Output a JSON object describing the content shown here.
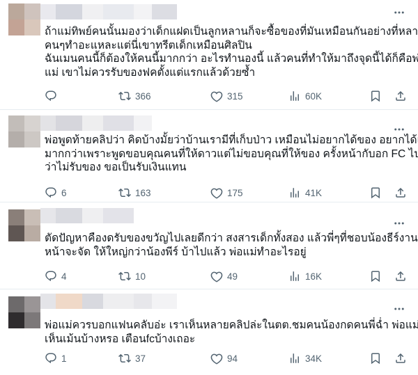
{
  "replies": [
    {
      "avatar_colors": [
        "#bba89b",
        "#cfc3bd",
        "#c3a395",
        "#d9c7bb"
      ],
      "header_blur": [
        "#e9e9ee",
        "#d4d6de",
        "#f0f0f2",
        "#e8eaef",
        "#f3f3f5",
        "#dcdde3"
      ],
      "lines": [
        "ถ้าแม่ทิพย์คนนั้นมองว่าเด็กแฝดเป็นลูกหลานก็จะซื้อของที่มันเหมือนกันอย่างที่หลาย",
        "คนๆทำอะแหละแต่นี่เขาทรีตเด็กเหมือนศิลปิน",
        "ฉันเมนคนนี้ก็ต้องให้คนนี้มากกว่า อะไรทำนองนี้ แล้วคนที่ทำให้มาถึงจุดนี้ได้ก็คือพ่อกับ",
        "แม่ เขาไม่ควรรับของฟคตั้งแต่แรกแล้วด้วยซ้ำ"
      ],
      "reply_count": "",
      "retweet_count": "366",
      "like_count": "315",
      "view_count": "60K"
    },
    {
      "avatar_colors": [
        "#c2bdb9",
        "#d7d3d0",
        "#b4aeaa",
        "#cdc8c4"
      ],
      "header_blur": [
        "#e3e3e6",
        "#d6d6dc",
        "#eeeeef",
        "#e0e0e6",
        "#f2f2f4"
      ],
      "lines": [
        "พ่อพูดท้ายคลิปว่า คิดบ้างมั้ยว่าบ้านเรามีที่เก็บป่าว เหมือนไม่อยากได้ของ อยากได้เงิน",
        "มากกว่าเพราะพูดขอบคุณคนที่ให้ดาวแต่ไม่ขอบคุณที่ให้ของ ครั้งหน้ากับอก FC ไปสิ",
        "ว่าไม่รับของ ขอเป็นรับเงินแทน"
      ],
      "reply_count": "6",
      "retweet_count": "163",
      "like_count": "175",
      "view_count": "41K"
    },
    {
      "avatar_colors": [
        "#8a7f79",
        "#c9beb6",
        "#5f5653",
        "#b9aca3"
      ],
      "header_blur": [
        "#e6e6ea",
        "#d9dae0",
        "#efeff1",
        "#e3e3e9"
      ],
      "lines": [
        "ตัดปัญหาคืองดรับของขวัญไปเลยดีกว่า สงสารเด็กทั้งสอง แล้วพี่ๆที่ชอบน้องธีร์งาน",
        "หน้าจะจัด ให้ใหญ่กว่าน้องพีร์ บ้าไปแล้ว พ่อแม่ทำอะไรอยู่"
      ],
      "reply_count": "4",
      "retweet_count": "10",
      "like_count": "49",
      "view_count": "16K"
    },
    {
      "avatar_colors": [
        "#6d6a6b",
        "#9a9596",
        "#2f2c2e",
        "#7c7879"
      ],
      "header_blur": [
        "#e4e4e8",
        "#f0d9c8",
        "#d8d9df",
        "#eeeef0",
        "#e7e7eb",
        "#f3f3f5"
      ],
      "lines": [
        "พ่อแม่ควรบอกแฟนคลับอ่ะ เราเห็นหลายคลิปล่ะในตต.ชมคนน้องกดคนพี่ฉ่ำ พ่อแม่ไม่",
        "เห็นเม้นบ้างหรอ เตือนfcบ้างเถอะ"
      ],
      "reply_count": "1",
      "retweet_count": "37",
      "like_count": "94",
      "view_count": "34K"
    }
  ]
}
